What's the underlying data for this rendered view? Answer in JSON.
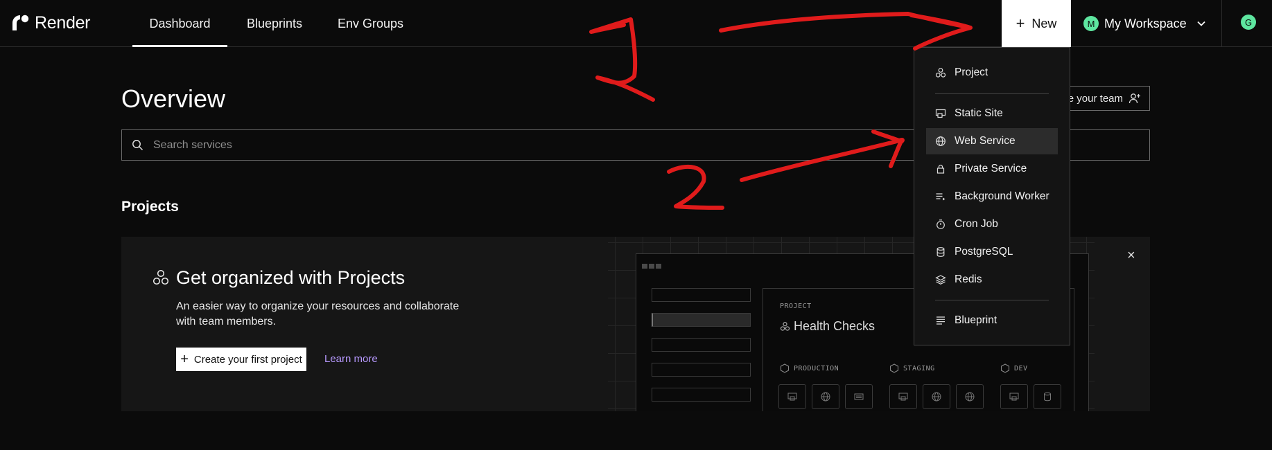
{
  "brand": {
    "name": "Render"
  },
  "nav": {
    "tabs": [
      {
        "label": "Dashboard",
        "active": true
      },
      {
        "label": "Blueprints",
        "active": false
      },
      {
        "label": "Env Groups",
        "active": false
      }
    ],
    "new_label": "New",
    "workspace_initial": "M",
    "workspace_label": "My Workspace",
    "user_initial": "G"
  },
  "main": {
    "title": "Overview",
    "invite_label": "Invite your team",
    "search_placeholder": "Search services",
    "projects_title": "Projects"
  },
  "card": {
    "heading": "Get organized with Projects",
    "description": "An easier way to organize your resources and collaborate with team members.",
    "create_label": "Create your first project",
    "learn_more": "Learn more",
    "close_glyph": "×",
    "illustration": {
      "project_label": "PROJECT",
      "project_name": "Health Checks",
      "environments": [
        "PRODUCTION",
        "STAGING",
        "DEV"
      ]
    }
  },
  "menu": {
    "items": [
      {
        "label": "Project",
        "icon": "project-icon"
      },
      {
        "label": "Static Site",
        "icon": "static-site-icon"
      },
      {
        "label": "Web Service",
        "icon": "globe-icon",
        "highlighted": true
      },
      {
        "label": "Private Service",
        "icon": "lock-icon"
      },
      {
        "label": "Background Worker",
        "icon": "worker-icon"
      },
      {
        "label": "Cron Job",
        "icon": "stopwatch-icon"
      },
      {
        "label": "PostgreSQL",
        "icon": "database-icon"
      },
      {
        "label": "Redis",
        "icon": "layers-icon"
      },
      {
        "label": "Blueprint",
        "icon": "blueprint-icon"
      }
    ]
  },
  "annotations": {
    "step_1": "1",
    "step_2": "2",
    "color": "#e01b1b"
  },
  "colors": {
    "background": "#0b0b0b",
    "link": "#b799ff",
    "avatar": "#5ee6a0"
  }
}
